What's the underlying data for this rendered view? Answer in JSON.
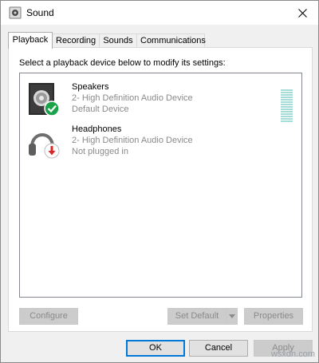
{
  "window": {
    "title": "Sound"
  },
  "icons": {
    "app": "speaker-icon",
    "close": "close-icon"
  },
  "tabs": [
    {
      "label": "Playback",
      "active": true
    },
    {
      "label": "Recording",
      "active": false
    },
    {
      "label": "Sounds",
      "active": false
    },
    {
      "label": "Communications",
      "active": false
    }
  ],
  "panel": {
    "instruction": "Select a playback device below to modify its settings:"
  },
  "devices": [
    {
      "name": "Speakers",
      "line1": "2- High Definition Audio Device",
      "line2": "Default Device",
      "icon": "speaker-icon",
      "status_icon": "check-icon",
      "status_color": "#1aa34a"
    },
    {
      "name": "Headphones",
      "line1": "2- High Definition Audio Device",
      "line2": "Not plugged in",
      "icon": "headphones-icon",
      "status_icon": "down-arrow-icon",
      "status_color": "#d92626"
    }
  ],
  "buttons": {
    "configure": "Configure",
    "set_default": "Set Default",
    "properties": "Properties",
    "ok": "OK",
    "cancel": "Cancel",
    "apply": "Apply"
  },
  "watermark": "wsxdn.com"
}
